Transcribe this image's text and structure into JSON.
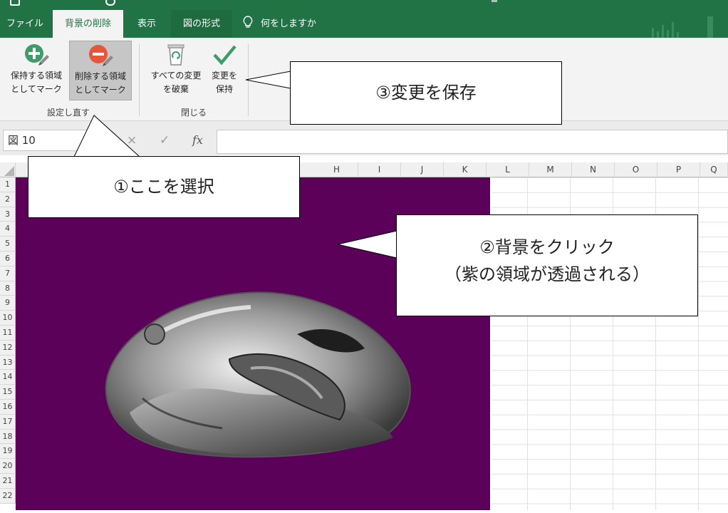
{
  "tabs": [
    "ファイル",
    "背景の削除",
    "表示",
    "図の形式"
  ],
  "tell_me": "何をしますか",
  "ribbon": {
    "keep_line1": "保持する領域",
    "keep_line2": "としてマーク",
    "remove_line1": "削除する領域",
    "remove_line2": "としてマーク",
    "discard_line1": "すべての変更",
    "discard_line2": "を破棄",
    "save_line1": "変更を",
    "save_line2": "保持",
    "group_refine": "設定し直す",
    "group_close": "閉じる"
  },
  "formula_bar": {
    "name_box": "図 10",
    "cancel_symbol": "×",
    "enter_symbol": "✓",
    "fx": "fx"
  },
  "columns": [
    "H",
    "I",
    "J",
    "K",
    "L",
    "M",
    "N",
    "O",
    "P",
    "Q"
  ],
  "rows": [
    "1",
    "2",
    "3",
    "4",
    "5",
    "6",
    "7",
    "8",
    "9",
    "10",
    "11",
    "12",
    "13",
    "14",
    "15",
    "16",
    "17",
    "18",
    "19",
    "20",
    "21",
    "22"
  ],
  "callouts": {
    "one": "①ここを選択",
    "two_line1": "②背景をクリック",
    "two_line2": "（紫の領域が透過される）",
    "three": "③変更を保存"
  },
  "colors": {
    "excel_green": "#217346",
    "removal_purple": "#5c0159"
  }
}
